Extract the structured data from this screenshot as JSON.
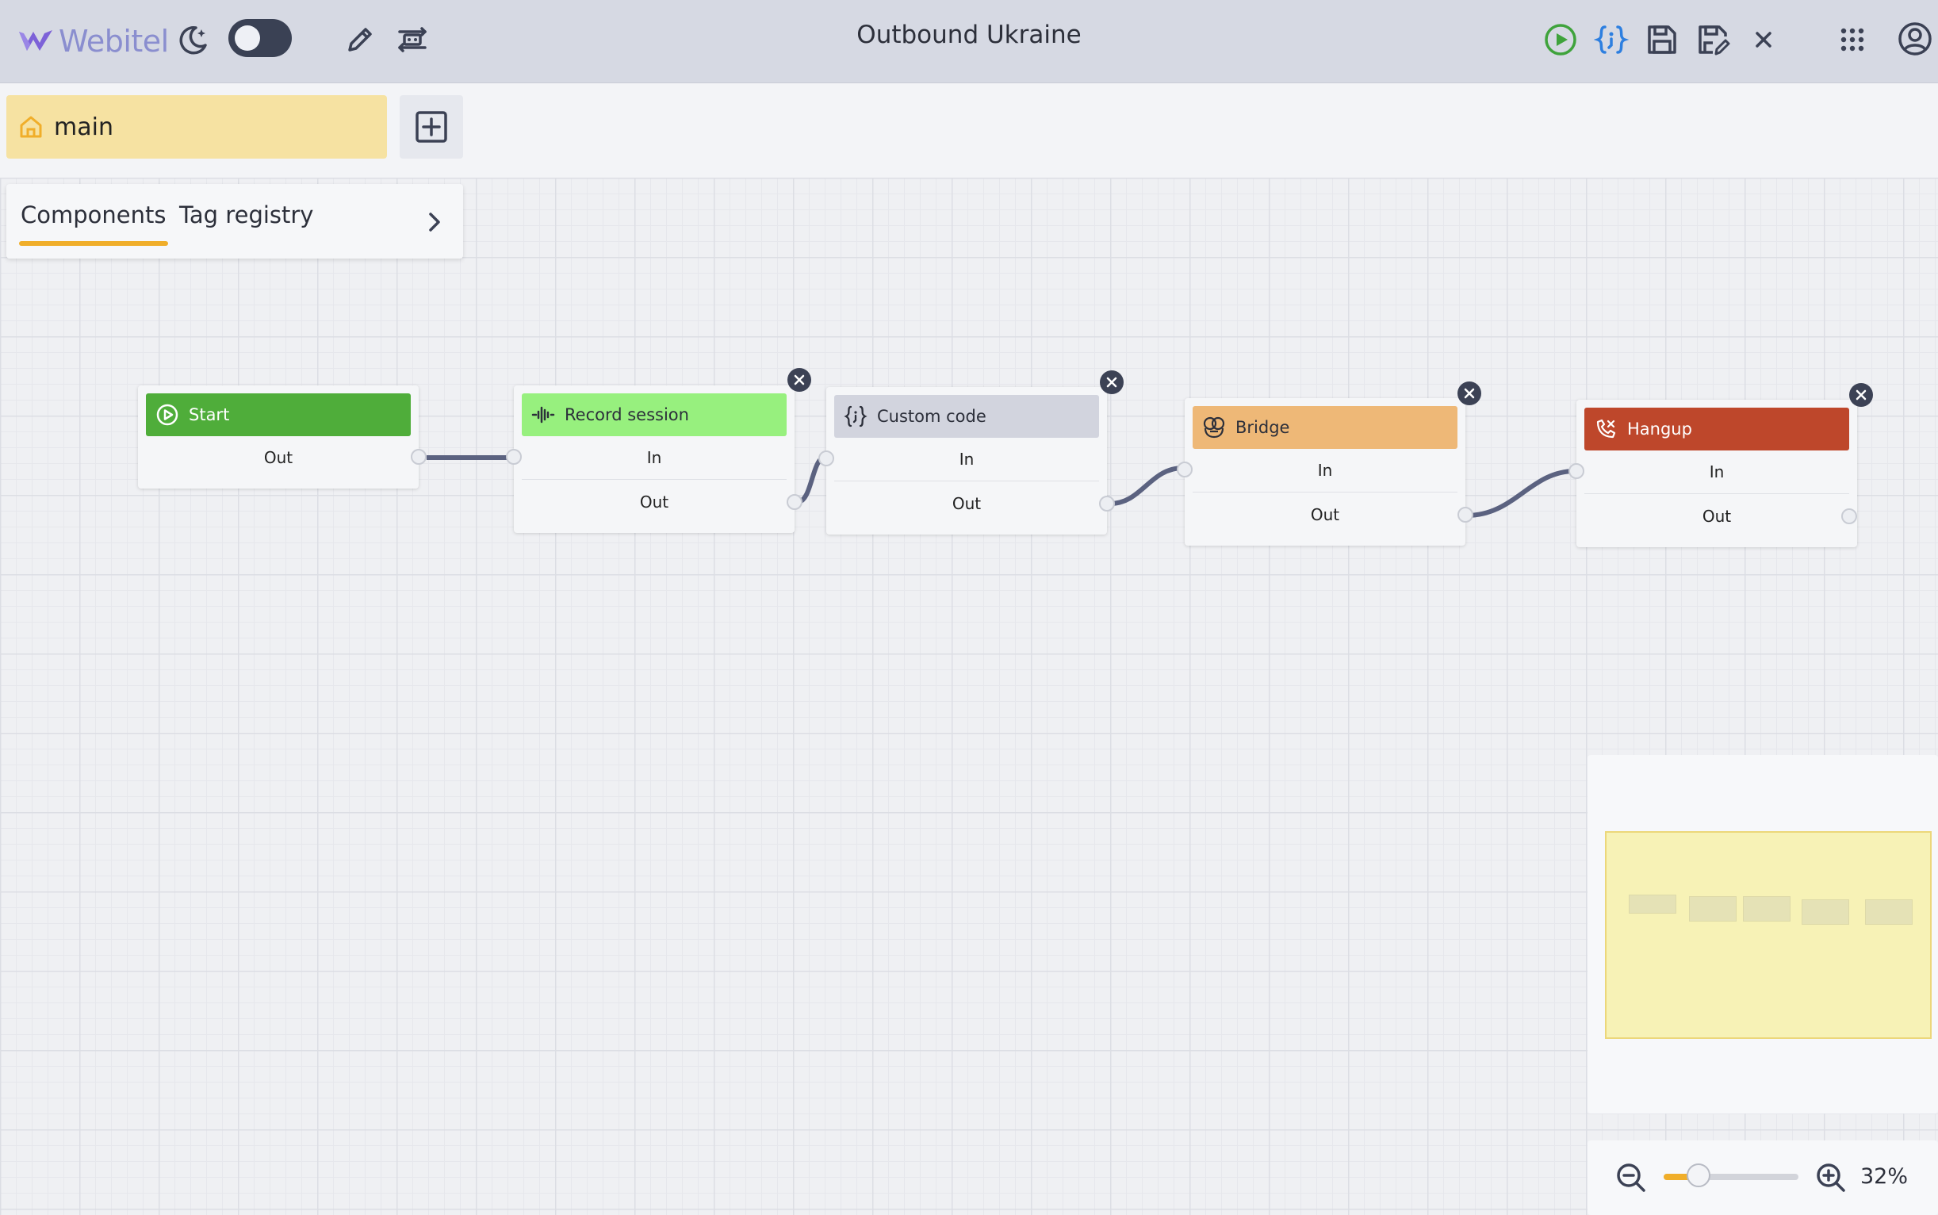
{
  "header": {
    "brand": "Webitel",
    "title": "Outbound Ukraine",
    "icons": [
      "moon-icon",
      "theme-toggle",
      "pencil-icon",
      "flow-settings-icon",
      "run-icon",
      "code-icon",
      "save-icon",
      "save-as-icon",
      "close-icon",
      "apps-grid-icon",
      "account-icon"
    ],
    "colors": {
      "run": "#3fa33c",
      "code": "#2d7fe0",
      "dark": "#3b4154"
    }
  },
  "tabs": {
    "main_label": "main"
  },
  "sidepanel": {
    "components_label": "Components",
    "tag_registry_label": "Tag registry"
  },
  "nodes": [
    {
      "title": "Start",
      "color": "#4fad3a",
      "text_color": "#ffffff",
      "ports": [
        "Out"
      ]
    },
    {
      "title": "Record session",
      "color": "#97f07e",
      "text_color": "#2c2f3a",
      "ports": [
        "In",
        "Out"
      ]
    },
    {
      "title": "Custom code",
      "color": "#d2d4de",
      "text_color": "#2c2f3a",
      "ports": [
        "In",
        "Out"
      ]
    },
    {
      "title": "Bridge",
      "color": "#eeb877",
      "text_color": "#2c2f3a",
      "ports": [
        "In",
        "Out"
      ]
    },
    {
      "title": "Hangup",
      "color": "#be472b",
      "text_color": "#ffffff",
      "ports": [
        "In",
        "Out"
      ]
    }
  ],
  "zoom": {
    "percent": 32,
    "label": "32%"
  }
}
